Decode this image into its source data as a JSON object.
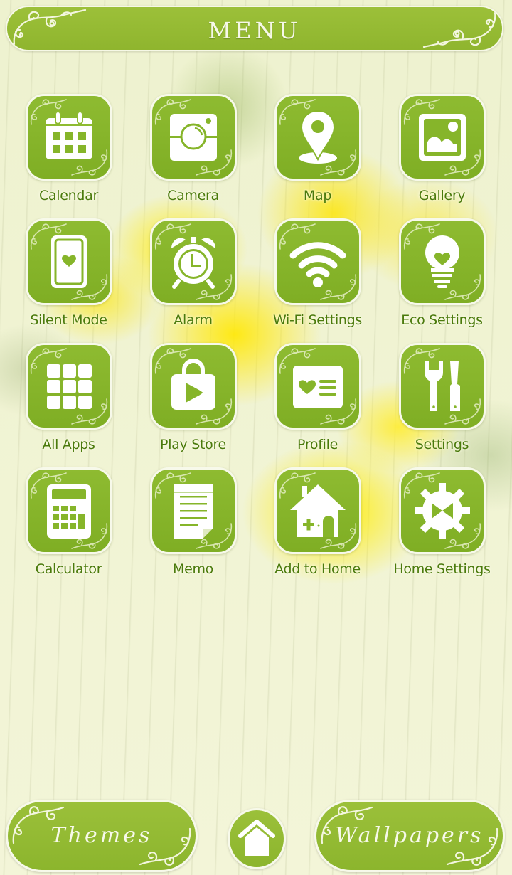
{
  "header": {
    "title": "MENU"
  },
  "apps": [
    {
      "label": "Calendar",
      "icon": "calendar-icon"
    },
    {
      "label": "Camera",
      "icon": "camera-icon"
    },
    {
      "label": "Map",
      "icon": "map-pin-icon"
    },
    {
      "label": "Gallery",
      "icon": "gallery-icon"
    },
    {
      "label": "Silent Mode",
      "icon": "silent-mode-icon"
    },
    {
      "label": "Alarm",
      "icon": "alarm-clock-icon"
    },
    {
      "label": "Wi-Fi Settings",
      "icon": "wifi-icon"
    },
    {
      "label": "Eco Settings",
      "icon": "lightbulb-heart-icon"
    },
    {
      "label": "All Apps",
      "icon": "app-grid-icon"
    },
    {
      "label": "Play Store",
      "icon": "play-store-bag-icon"
    },
    {
      "label": "Profile",
      "icon": "profile-card-icon"
    },
    {
      "label": "Settings",
      "icon": "wrench-screwdriver-icon"
    },
    {
      "label": "Calculator",
      "icon": "calculator-icon"
    },
    {
      "label": "Memo",
      "icon": "memo-icon"
    },
    {
      "label": "Add to Home",
      "icon": "add-to-home-icon"
    },
    {
      "label": "Home Settings",
      "icon": "home-settings-gear-icon"
    }
  ],
  "bottom_bar": {
    "themes_label": "Themes",
    "wallpapers_label": "Wallpapers",
    "home_icon": "home-icon"
  },
  "colors": {
    "accent_green": "#8fb52e",
    "label_green": "#4a7a0c",
    "cream": "#f7f9ea"
  }
}
